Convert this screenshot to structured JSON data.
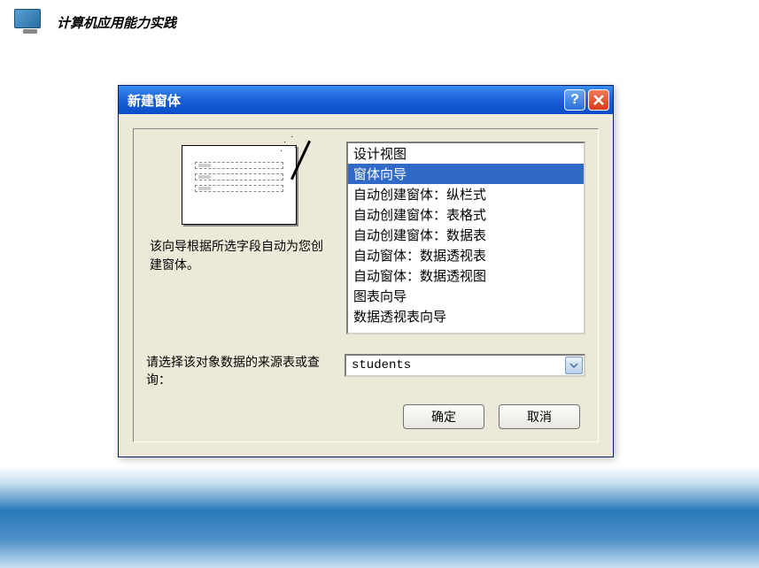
{
  "header": {
    "app_title": "计算机应用能力实践"
  },
  "dialog": {
    "title": "新建窗体",
    "description": "该向导根据所选字段自动为您创建窗体。",
    "source_label": "请选择该对象数据的来源表或查询：",
    "source_value": "students",
    "buttons": {
      "ok": "确定",
      "cancel": "取消"
    },
    "list": {
      "selected_index": 1,
      "items": [
        "设计视图",
        "窗体向导",
        "自动创建窗体：纵栏式",
        "自动创建窗体：表格式",
        "自动创建窗体：数据表",
        "自动窗体：数据透视表",
        "自动窗体：数据透视图",
        "图表向导",
        "数据透视表向导"
      ]
    }
  }
}
